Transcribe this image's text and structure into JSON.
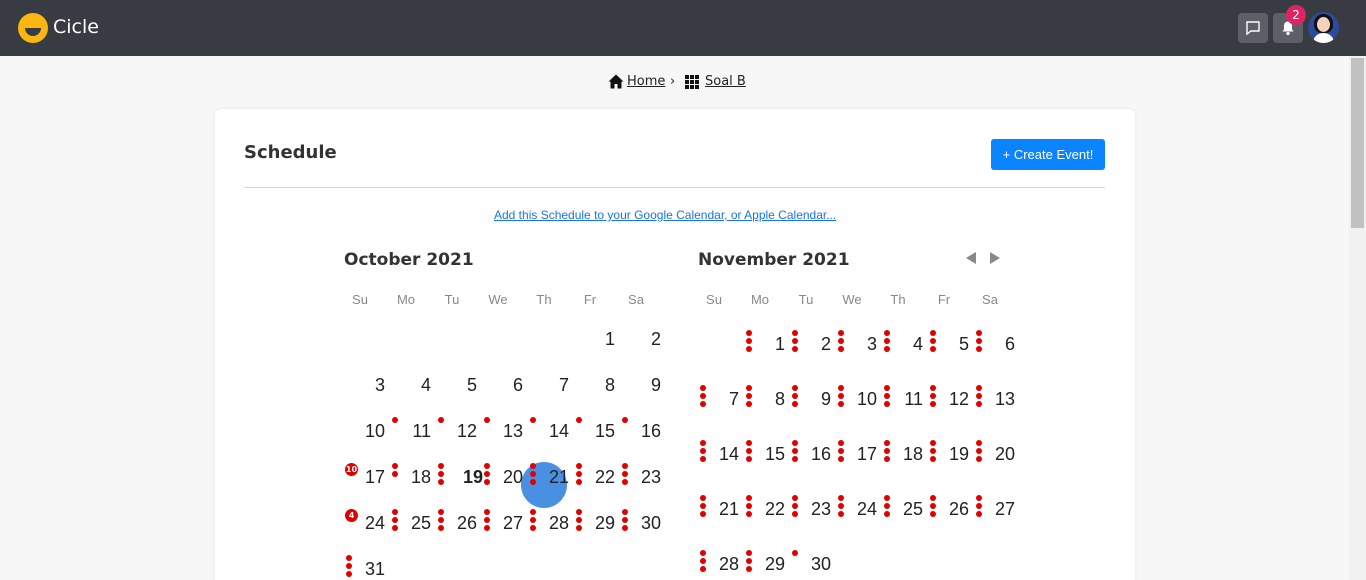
{
  "header": {
    "brand": "Cicle",
    "notification_count": "2"
  },
  "breadcrumb": {
    "home": "Home",
    "separator": "›",
    "current": "Soal B"
  },
  "page": {
    "title": "Schedule",
    "create_button": "+ Create Event!",
    "calendar_link": "Add this Schedule to your Google Calendar, or Apple Calendar..."
  },
  "weekdays": [
    "Su",
    "Mo",
    "Tu",
    "We",
    "Th",
    "Fr",
    "Sa"
  ],
  "calendars": [
    {
      "title": "October 2021",
      "first_weekday": 5,
      "days": 31,
      "today": 19,
      "dots": {
        "11": 1,
        "12": 1,
        "13": 1,
        "14": 1,
        "15": 1,
        "16": 1,
        "18": 2,
        "19": 3,
        "20": 3,
        "21": 3,
        "22": 3,
        "23": 3,
        "25": 3,
        "26": 3,
        "27": 3,
        "28": 3,
        "29": 3,
        "30": 3,
        "31": 3
      },
      "counts": {
        "17": "10",
        "24": "4"
      }
    },
    {
      "title": "November 2021",
      "first_weekday": 1,
      "days": 30,
      "today": null,
      "dots": {
        "1": 3,
        "2": 3,
        "3": 3,
        "4": 3,
        "5": 3,
        "6": 3,
        "7": 3,
        "8": 3,
        "9": 3,
        "10": 3,
        "11": 3,
        "12": 3,
        "13": 3,
        "14": 3,
        "15": 3,
        "16": 3,
        "17": 3,
        "18": 3,
        "19": 3,
        "20": 3,
        "21": 3,
        "22": 3,
        "23": 3,
        "24": 3,
        "25": 3,
        "26": 3,
        "27": 3,
        "28": 3,
        "29": 3,
        "30": 1
      },
      "counts": {}
    }
  ],
  "colors": {
    "topbar": "#383b42",
    "accent": "#0a84ff",
    "today": "#4a90e2",
    "event_dot": "#e00000",
    "badge": "#e02363"
  }
}
